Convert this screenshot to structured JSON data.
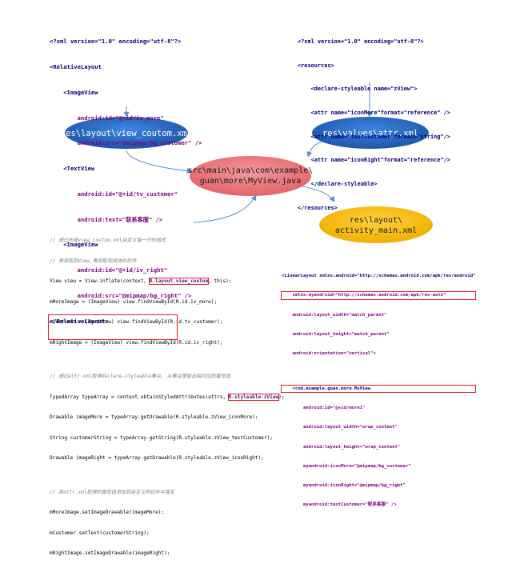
{
  "layout_xml": {
    "lines": [
      "<?xml version=\"1.0\" encoding=\"utf-8\"?>",
      "<RelativeLayout",
      "    <ImageView",
      "        android:id=\"@+id/iv_more\"",
      "        android:src=\"@mipmap/bg_customer\" />",
      "    <TextView",
      "        android:id=\"@+id/tv_customer\"",
      "        android:text=\"联系客服\" />",
      "    <ImageView",
      "        android:id=\"@+id/iv_right\"",
      "        android:src=\"@mipmap/bg_right\" />",
      "</RelativeLayout>"
    ]
  },
  "attr_xml": {
    "lines": [
      "<?xml version=\"1.0\" encoding=\"utf-8\"?>",
      "<resources>",
      "    <declare-styleable name=\"zView\">",
      "    <attr name=\"iconMore\"format=\"reference\" />",
      "    <attr name=\"textCustomer\"format=\"string\"/>",
      "    <attr name=\"iconRight\"format=\"reference\"/>",
      "    </declare-styleable>",
      "</resources>"
    ]
  },
  "nodes": {
    "layout_file": "res\\layout\\view_coutom.xml",
    "attr_file": "res\\values\\attr.xml",
    "java_file_line1": "src\\main\\java\\com\\example\\",
    "java_file_line2": "guan\\more\\MyView.java",
    "activity_file_line1": "res\\layout\\",
    "activity_file_line2": "activity_main.xml"
  },
  "java_code": {
    "comment1": "// 通过布局view_custom.xml自定义每一行的格式",
    "comment2": "// 再获取到View,再获取到具体的控件",
    "line1_pre": "View view = View.inflate(context, ",
    "line1_hl": "R.layout.view_coutom",
    "line1_post": ", this);",
    "line2": "mMoreImage = (ImageView) view.findViewById(R.id.iv_more);",
    "line3": "mCustomer = (TextView) view.findViewById(R.id.tv_customer);",
    "line4": "mRightImage = (ImageView) view.findViewById(R.id.iv_right);",
    "comment3": "// 通过attr.xml取得declare-styleable集合, 从集合里取出相对应的属性值",
    "line5_pre": "TypedArray typeArray = context.obtainStyledAttributes(attrs, ",
    "line5_hl": "R.styleable.zView",
    "line5_post": ");",
    "line6": "Drawable imageMore = typeArray.getDrawable(R.styleable.zView_iconMore);",
    "line7": "String customerString = typeArray.getString(R.styleable.zView_textCustomer);",
    "line8": "Drawable imageRight = typeArray.getDrawable(R.styleable.zView_iconRight);",
    "comment4": "// 将attr.xml取得的属性值添加到自定义的控件中保定",
    "line9": "mMoreImage.setImageDrawable(imageMore);",
    "line10": "mCustomer.setText(customerString);",
    "line11": "mRightImage.setImageDrawable(imageRight);"
  },
  "activity_xml": {
    "lines": [
      "<LinearLayout xmlns:android=\"http://schemas.android.com/apk/res/android\"",
      "    xmlns:myandroid=\"http://schemas.android.com/apk/res-auto\"",
      "    android:layout_width=\"match_parent\"",
      "    android:layout_height=\"match_parent\"",
      "    android:orientation=\"vertical\">",
      "",
      "    <com.example.guan.more.MyView",
      "        android:id=\"@+id/more1\"",
      "        android:layout_width=\"wrap_content\"",
      "        android:layout_height=\"wrap_content\"",
      "        myandroid:iconMore=\"@mipmap/bg_customer\"",
      "        myandroid:iconRight=\"@mipmap/bg_right\"",
      "        myandroid:textCustomer=\"联系客服\" />"
    ]
  },
  "colors": {
    "blue_node": "#2b6cc4",
    "red_node": "#ec7c80",
    "yellow_node": "#ffc000",
    "arrow": "#5b8fd4",
    "highlight": "#e02020"
  }
}
